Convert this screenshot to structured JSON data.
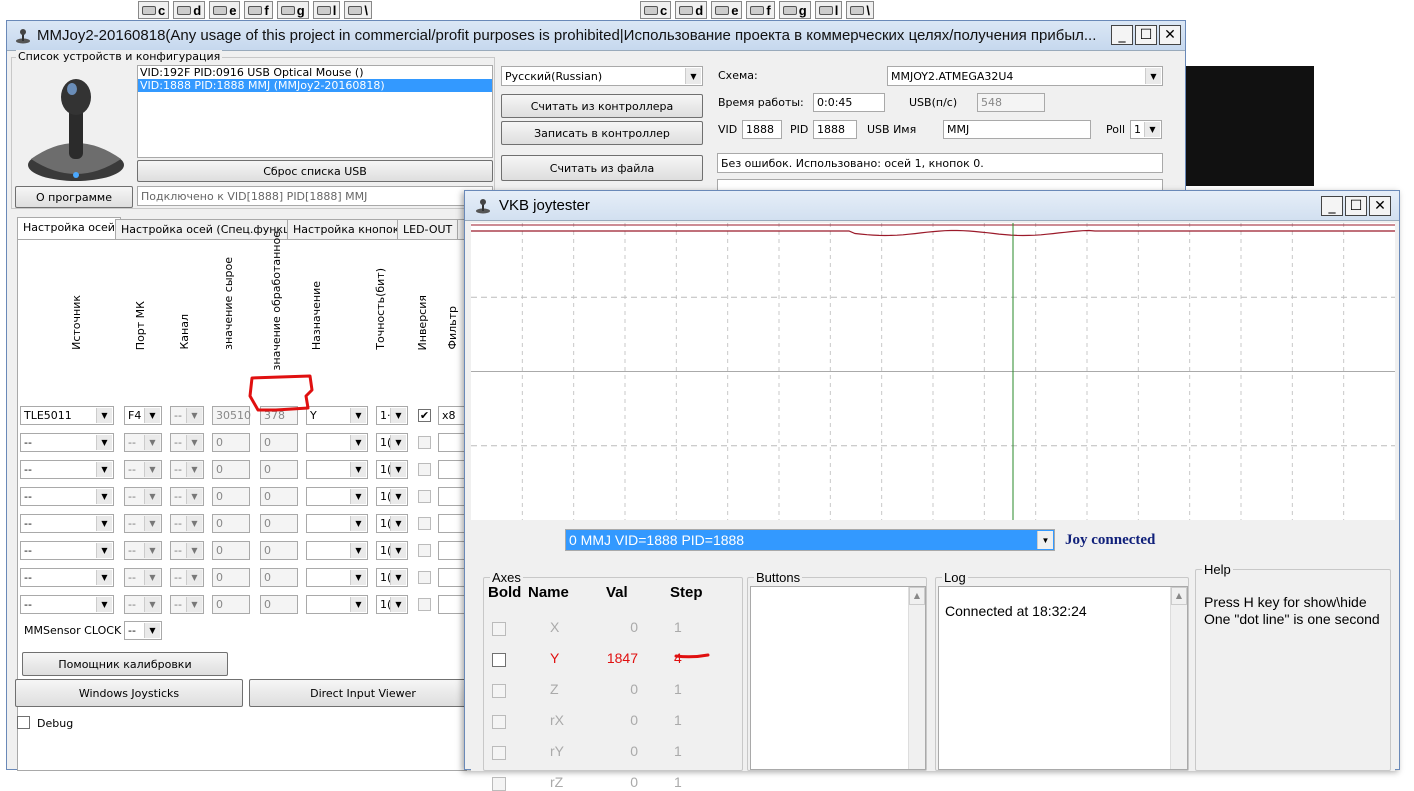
{
  "background": {
    "left_drives": [
      {
        "label": "c"
      },
      {
        "label": "d"
      },
      {
        "label": "e"
      },
      {
        "label": "f"
      },
      {
        "label": "g"
      },
      {
        "label": "l"
      },
      {
        "label": "\\"
      }
    ],
    "right_drives": [
      {
        "label": "c"
      },
      {
        "label": "d"
      },
      {
        "label": "e"
      },
      {
        "label": "f"
      },
      {
        "label": "g"
      },
      {
        "label": "l"
      },
      {
        "label": "\\"
      }
    ]
  },
  "mmjoy": {
    "title": "MMJoy2-20160818(Any usage of this project in commercial/profit purposes is prohibited|Использование проекта в коммерческих целях/получения прибыл...",
    "devices_group_label": "Список устройств и конфигурация",
    "devices": [
      {
        "label": "VID:192F PID:0916 USB Optical Mouse ()",
        "selected": false
      },
      {
        "label": "VID:1888 PID:1888 MMJ (MMJoy2-20160818)",
        "selected": true
      }
    ],
    "reset_usb_button": "Сброс списка USB",
    "about_button": "О программе",
    "status_connected": "Подключено к VID[1888] PID[1888] MMJ",
    "language": "Русский(Russian)",
    "read_controller_button": "Считать из контроллера",
    "write_controller_button": "Записать в контроллер",
    "read_file_button": "Считать из файла",
    "scheme_label": "Схема:",
    "scheme_value": "MMJOY2.ATMEGA32U4",
    "uptime_label": "Время работы:",
    "uptime_value": "0:0:45",
    "usb_rate_label": "USB(п/с)",
    "usb_rate_value": "548",
    "vid_label": "VID",
    "vid_value": "1888",
    "pid_label": "PID",
    "pid_value": "1888",
    "usb_name_label": "USB Имя",
    "usb_name_value": "MMJ",
    "poll_label": "Poll",
    "poll_value": "1",
    "summary": "Без ошибок. Использовано: осей  1, кнопок  0.",
    "tabs": [
      {
        "label": "Настройка осей",
        "active": true
      },
      {
        "label": "Настройка осей (Спец.функции)",
        "active": false
      },
      {
        "label": "Настройка кнопок",
        "active": false
      },
      {
        "label": "LED-OUT",
        "active": false
      },
      {
        "label": "П",
        "active": false
      }
    ],
    "columns": {
      "source": "Источник",
      "port": "Порт МК",
      "channel": "Канал",
      "raw": "значение сырое",
      "processed": "значение обработанное",
      "assign": "Назначение",
      "precision": "Точность(бит)",
      "invert": "Инверсия",
      "filter": "Фильтр"
    },
    "axis_rows": [
      {
        "source": "TLE5011",
        "port": "F4",
        "channel": "--",
        "raw": "30510",
        "processed": "378",
        "assign": "Y",
        "precision": "1·",
        "invert": true,
        "filter": "x8",
        "active": true
      },
      {
        "source": "--",
        "port": "--",
        "channel": "--",
        "raw": "0",
        "processed": "0",
        "assign": "",
        "precision": "1(",
        "invert": false,
        "filter": "",
        "active": false
      },
      {
        "source": "--",
        "port": "--",
        "channel": "--",
        "raw": "0",
        "processed": "0",
        "assign": "",
        "precision": "1(",
        "invert": false,
        "filter": "",
        "active": false
      },
      {
        "source": "--",
        "port": "--",
        "channel": "--",
        "raw": "0",
        "processed": "0",
        "assign": "",
        "precision": "1(",
        "invert": false,
        "filter": "",
        "active": false
      },
      {
        "source": "--",
        "port": "--",
        "channel": "--",
        "raw": "0",
        "processed": "0",
        "assign": "",
        "precision": "1(",
        "invert": false,
        "filter": "",
        "active": false
      },
      {
        "source": "--",
        "port": "--",
        "channel": "--",
        "raw": "0",
        "processed": "0",
        "assign": "",
        "precision": "1(",
        "invert": false,
        "filter": "",
        "active": false
      },
      {
        "source": "--",
        "port": "--",
        "channel": "--",
        "raw": "0",
        "processed": "0",
        "assign": "",
        "precision": "1(",
        "invert": false,
        "filter": "",
        "active": false
      },
      {
        "source": "--",
        "port": "--",
        "channel": "--",
        "raw": "0",
        "processed": "0",
        "assign": "",
        "precision": "1(",
        "invert": false,
        "filter": "",
        "active": false
      }
    ],
    "mmsensor_label": "MMSensor CLOCK",
    "mmsensor_value": "--",
    "calibration_button": "Помощник калибровки",
    "windows_joysticks_button": "Windows Joysticks",
    "direct_input_button": "Direct Input Viewer",
    "debug_label": "Debug"
  },
  "vkb": {
    "title": "VKB joytester",
    "device_select": "0 MMJ VID=1888 PID=1888",
    "status": "Joy connected",
    "axes_group": "Axes",
    "axes_headers": {
      "bold": "Bold",
      "name": "Name",
      "val": "Val",
      "step": "Step"
    },
    "axes": [
      {
        "name": "X",
        "val": "0",
        "step": "1",
        "active": false
      },
      {
        "name": "Y",
        "val": "1847",
        "step": "4",
        "active": true
      },
      {
        "name": "Z",
        "val": "0",
        "step": "1",
        "active": false
      },
      {
        "name": "rX",
        "val": "0",
        "step": "1",
        "active": false
      },
      {
        "name": "rY",
        "val": "0",
        "step": "1",
        "active": false
      },
      {
        "name": "rZ",
        "val": "0",
        "step": "1",
        "active": false
      }
    ],
    "buttons_group": "Buttons",
    "log_group": "Log",
    "log_text": "Connected at 18:32:24",
    "help_group": "Help",
    "help_line1": "Press H key for show\\hide",
    "help_line2": "One \"dot line\" is one second",
    "colors": {
      "status": "#10207a",
      "active_axis": "#e01010",
      "trace": "#9b1a2a",
      "cursor": "#2a8a2a",
      "select_bg": "#3399ff"
    }
  }
}
